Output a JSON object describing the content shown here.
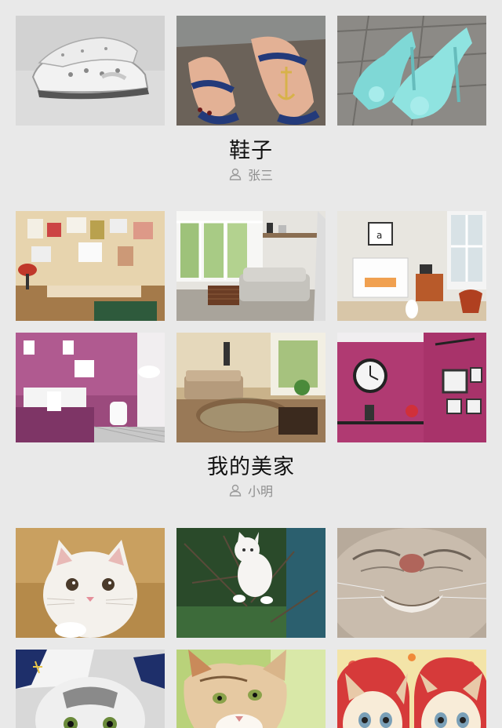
{
  "albums": [
    {
      "title": "鞋子",
      "author": "张三",
      "photos": [
        "sneakers-photo",
        "sandals-photo",
        "heels-photo"
      ]
    },
    {
      "title": "我的美家",
      "author": "小明",
      "photos": [
        "studio-room-photo",
        "living-room-photo",
        "fireplace-room-photo",
        "bathroom-photo",
        "lounge-photo",
        "clock-wall-photo"
      ]
    },
    {
      "title": "",
      "author": "",
      "photos": [
        "white-kitten-photo",
        "kitten-branch-photo",
        "cat-closeup-photo",
        "sailor-kitten-photo",
        "tabby-kitten-photo",
        "cartoon-cats-photo"
      ]
    }
  ],
  "icons": {
    "author": "person-icon"
  }
}
